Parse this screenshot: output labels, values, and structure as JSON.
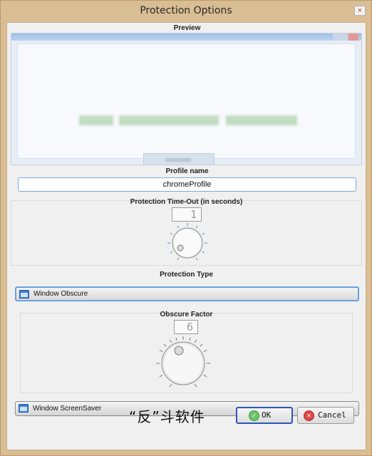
{
  "window": {
    "title": "Protection Options",
    "close_glyph": "×"
  },
  "preview": {
    "label": "Preview"
  },
  "profile": {
    "label": "Profile name",
    "value": "chromeProfile"
  },
  "timeout": {
    "label": "Protection Time-Out (in seconds)",
    "value": "1"
  },
  "protection_type": {
    "label": "Protection Type",
    "options": [
      {
        "label": "Window Obscure",
        "selected": true
      },
      {
        "label": "Window ScreenSaver",
        "selected": false
      }
    ]
  },
  "obscure": {
    "label": "Obscure Factor",
    "value": "6"
  },
  "footer": {
    "watermark": "“反”斗软件",
    "ok_label": "OK",
    "cancel_label": "Cancel"
  },
  "icons": {
    "close": "close-icon",
    "window_type": "window-icon",
    "ok": "checkmark-icon",
    "cancel": "x-circle-icon"
  }
}
